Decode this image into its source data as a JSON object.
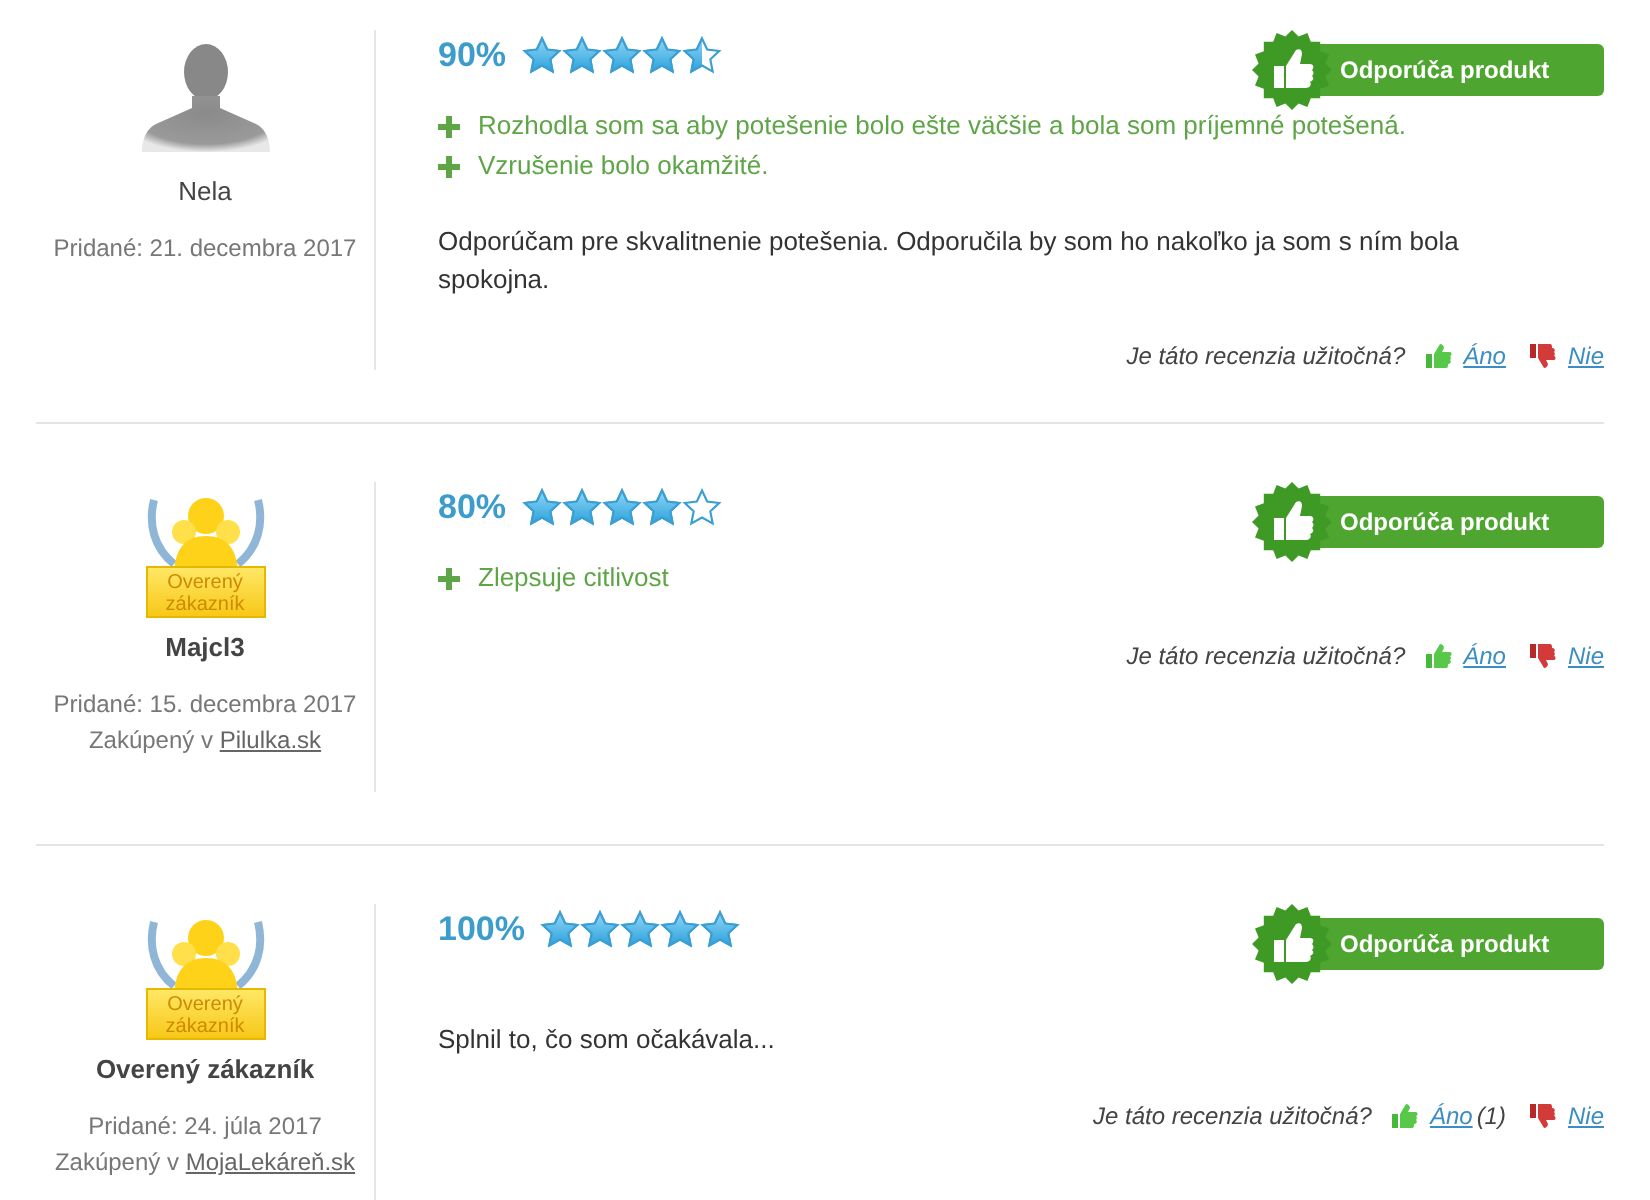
{
  "reviews": [
    {
      "avatar": {
        "kind": "silhouette"
      },
      "author": "Nela",
      "added": "Pridané: 21. decembra 2017",
      "percent": "90%",
      "stars": 4.5,
      "recommend": "Odporúča produkt",
      "pros": [
        "Rozhodla som sa aby potešenie bolo ešte väčšie a bola som príjemné potešená.",
        "Vzrušenie bolo okamžité."
      ],
      "body": "Odporúčam pre skvalitnenie potešenia. Odporučila by som ho nakoľko ja som s ním bola spokojna.",
      "helpful": {
        "question": "Je táto recenzia užitočná?",
        "yes": "Áno",
        "no": "Nie"
      }
    },
    {
      "avatar": {
        "kind": "verified",
        "label": "Overený zákazník"
      },
      "author": "Majcl3",
      "added": "Pridané: 15. decembra 2017",
      "purchased": {
        "text": "Zakúpený v",
        "shop": "Pilulka.sk"
      },
      "percent": "80%",
      "stars": 4,
      "recommend": "Odporúča produkt",
      "pros": [
        "Zlepsuje citlivost"
      ],
      "helpful": {
        "question": "Je táto recenzia užitočná?",
        "yes": "Áno",
        "no": "Nie"
      }
    },
    {
      "avatar": {
        "kind": "verified",
        "label": "Overený zákazník"
      },
      "author": "Overený zákazník",
      "added": "Pridané: 24. júla 2017",
      "purchased": {
        "text": "Zakúpený v",
        "shop": "MojaLekáreň.sk"
      },
      "percent": "100%",
      "stars": 5,
      "recommend": "Odporúča produkt",
      "body": "Splnil to, čo som očakávala...",
      "helpful": {
        "question": "Je táto recenzia užitočná?",
        "yes": "Áno",
        "yes_count": "(1)",
        "no": "Nie"
      }
    }
  ]
}
